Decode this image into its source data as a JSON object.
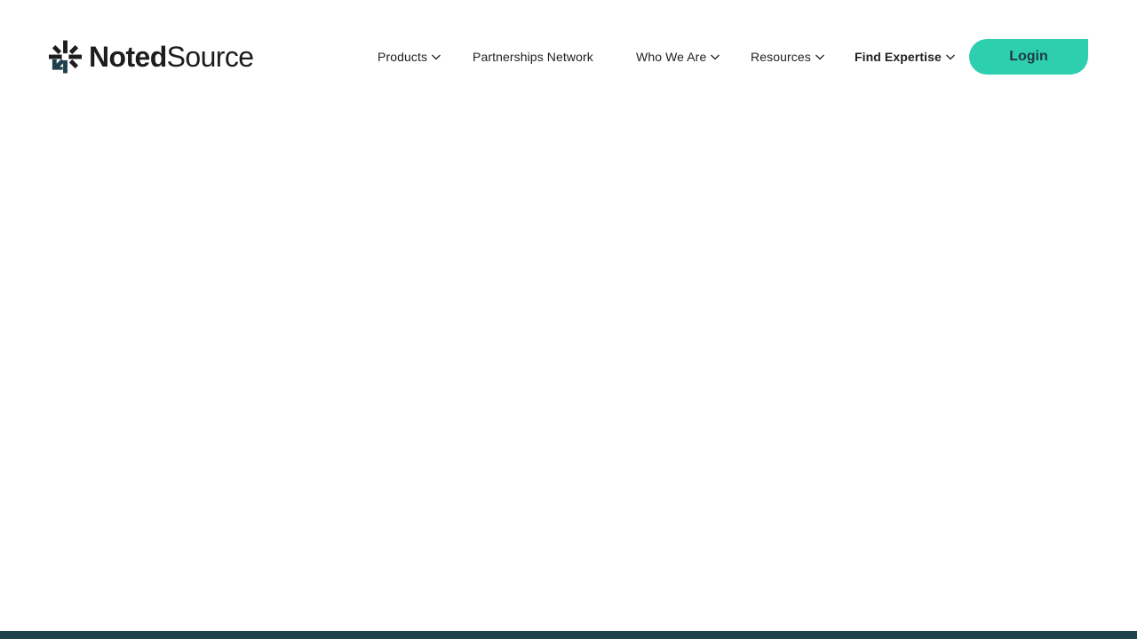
{
  "logo": {
    "brand_strong": "Noted",
    "brand_light": "Source",
    "icon": "noted-source-asterisk-logo"
  },
  "nav": {
    "items": [
      {
        "label": "Products",
        "has_dropdown": true,
        "icon": "chevron-down-icon"
      },
      {
        "label": "Partnerships Network",
        "has_dropdown": false
      },
      {
        "label": "Who We Are",
        "has_dropdown": true,
        "icon": "chevron-down-icon"
      },
      {
        "label": "Resources",
        "has_dropdown": true,
        "icon": "chevron-down-icon"
      },
      {
        "label": "Find Expertise",
        "has_dropdown": true,
        "icon": "chevron-down-icon",
        "emphasis": "bold"
      }
    ]
  },
  "login": {
    "label": "Login"
  },
  "colors": {
    "accent": "#2ecfae",
    "brand_dark": "#1e414b",
    "text": "#1f1f1f",
    "background": "#ffffff"
  }
}
